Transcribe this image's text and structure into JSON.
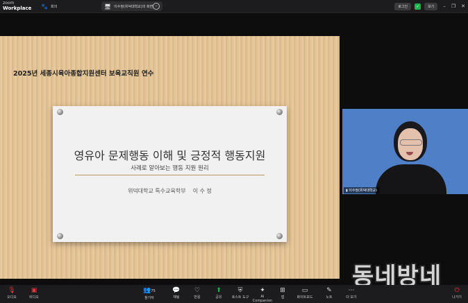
{
  "app": {
    "brand_top": "zoom",
    "brand_name": "Workplace"
  },
  "tabs": [
    {
      "icon": "🐾",
      "label": "회의"
    },
    {
      "icon": "🖥",
      "label": "이수정(위덕대학교)의 화면"
    }
  ],
  "titlebar_right": {
    "login": "로그인",
    "shield": "✓",
    "view": "보기"
  },
  "slide": {
    "header": "2025년 세종시육아종합지원센터 보육교직원 연수",
    "title": "영유아 문제행동 이해 및 긍정적 행동지원",
    "subtitle": "사례로 알아보는 행동 지원 원리",
    "author": "위덕대학교 특수교육학부    이 수 정"
  },
  "participant": {
    "name": "이수정(위덕대학교)"
  },
  "watermark": "동네방네",
  "toolbar": {
    "audio": "오디오",
    "video": "비디오",
    "participants": "참가자",
    "participants_count": "75",
    "chat": "채팅",
    "react": "반응",
    "share": "공유",
    "host_tools": "호스트 도구",
    "ai": "AI Companion",
    "apps": "앱",
    "whiteboard": "화이트보드",
    "notes": "노트",
    "more": "더 보기",
    "leave": "나가기"
  },
  "colors": {
    "accent_red": "#e0383e",
    "accent_green": "#1fb950",
    "tile_bg": "#4f7fc7"
  }
}
